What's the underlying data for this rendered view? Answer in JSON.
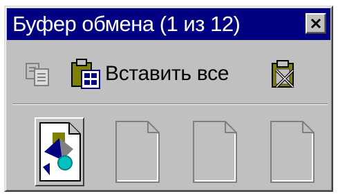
{
  "window": {
    "title": "Буфер обмена (1 из 12)",
    "close_icon": "close-icon"
  },
  "toolbar": {
    "copy_icon": "copy-icon",
    "paste_all_icon": "paste-icon",
    "paste_all_label": "Вставить все",
    "clear_icon": "clear-clipboard-icon"
  },
  "clipboard": {
    "capacity": 12,
    "filled": 1,
    "slots": [
      {
        "state": "filled",
        "icon": "clipboard-item-icon"
      },
      {
        "state": "empty",
        "icon": "empty-slot-icon"
      },
      {
        "state": "empty",
        "icon": "empty-slot-icon"
      },
      {
        "state": "empty",
        "icon": "empty-slot-icon"
      }
    ]
  },
  "colors": {
    "titlebar": "#000080",
    "face": "#c0c0c0",
    "shadow": "#808080",
    "highlight": "#ffffff"
  }
}
